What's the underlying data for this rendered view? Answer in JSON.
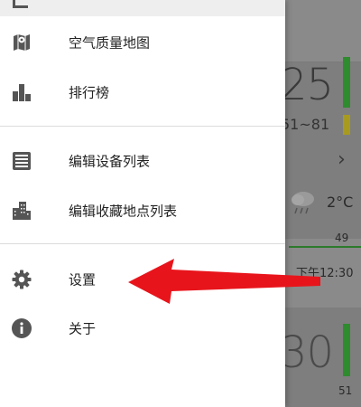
{
  "background": {
    "card1": {
      "value": "25",
      "range": "51~81",
      "temperature": "2°C",
      "aqi": "49",
      "time": "下午12:30"
    },
    "card2": {
      "value": "30",
      "aqi": "51"
    }
  },
  "drawer": {
    "items": [
      {
        "label": "空气质量地图",
        "icon": "map-icon"
      },
      {
        "label": "排行榜",
        "icon": "bar-chart-icon"
      },
      {
        "label": "编辑设备列表",
        "icon": "device-list-icon"
      },
      {
        "label": "编辑收藏地点列表",
        "icon": "city-building-icon"
      },
      {
        "label": "设置",
        "icon": "gear-icon"
      },
      {
        "label": "关于",
        "icon": "info-icon"
      }
    ]
  },
  "colors": {
    "drawer_bg": "#ffffff",
    "header_bg": "#eeeeee",
    "icon": "#555555",
    "arrow": "#e8141b",
    "aqi_good": "#2e8b2e",
    "aqi_moderate": "#a89a1e"
  }
}
